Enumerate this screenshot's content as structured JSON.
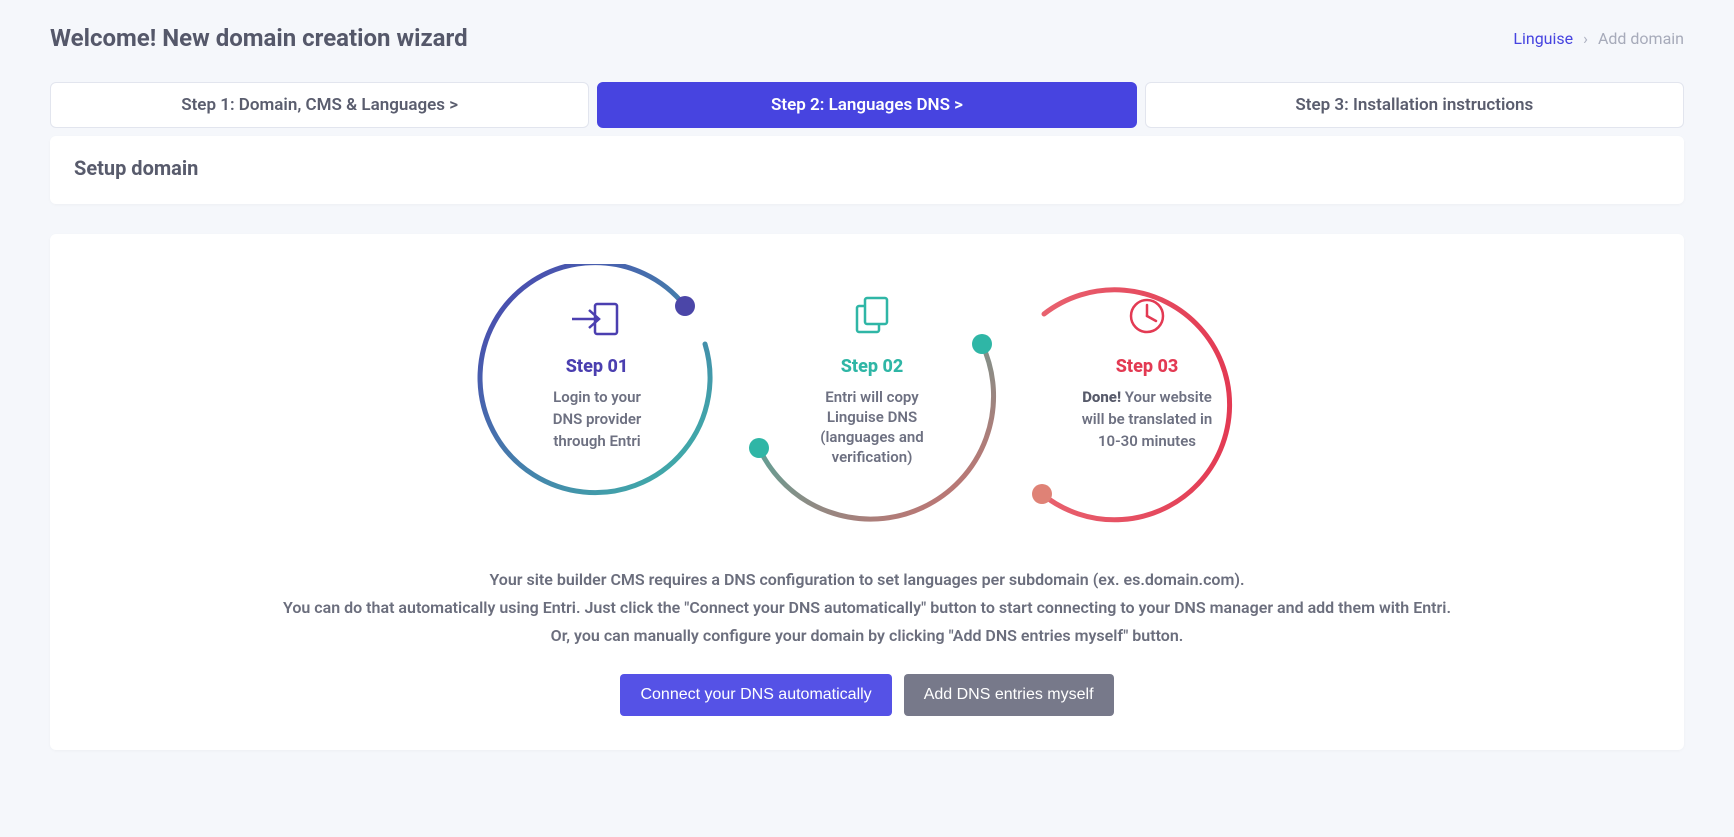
{
  "header": {
    "title": "Welcome! New domain creation wizard"
  },
  "breadcrumb": {
    "root": "Linguise",
    "current": "Add domain"
  },
  "tabs": {
    "step1": "Step 1: Domain, CMS & Languages  >",
    "step2": "Step 2: Languages DNS  >",
    "step3": "Step 3: Installation instructions"
  },
  "panel": {
    "title": "Setup domain"
  },
  "diagram": {
    "step1": {
      "label": "Step 01",
      "line1": "Login to your",
      "line2": "DNS provider",
      "line3": "through Entri"
    },
    "step2": {
      "label": "Step 02",
      "line1": "Entri will copy",
      "line2": "Linguise DNS",
      "line3": "(languages and",
      "line4": "verification)"
    },
    "step3": {
      "label": "Step 03",
      "line1_bold": "Done!",
      "line1_rest": " Your website",
      "line2": "will be translated in",
      "line3": "10-30 minutes"
    }
  },
  "description": {
    "line1": "Your site builder CMS requires a DNS configuration to set languages per subdomain (ex. es.domain.com).",
    "line2": "You can do that automatically using Entri. Just click the \"Connect your DNS automatically\" button to start connecting to your DNS manager and add them with Entri.",
    "line3": "Or, you can manually configure your domain by clicking \"Add DNS entries myself\" button."
  },
  "buttons": {
    "connect": "Connect your DNS automatically",
    "manual": "Add DNS entries myself"
  }
}
